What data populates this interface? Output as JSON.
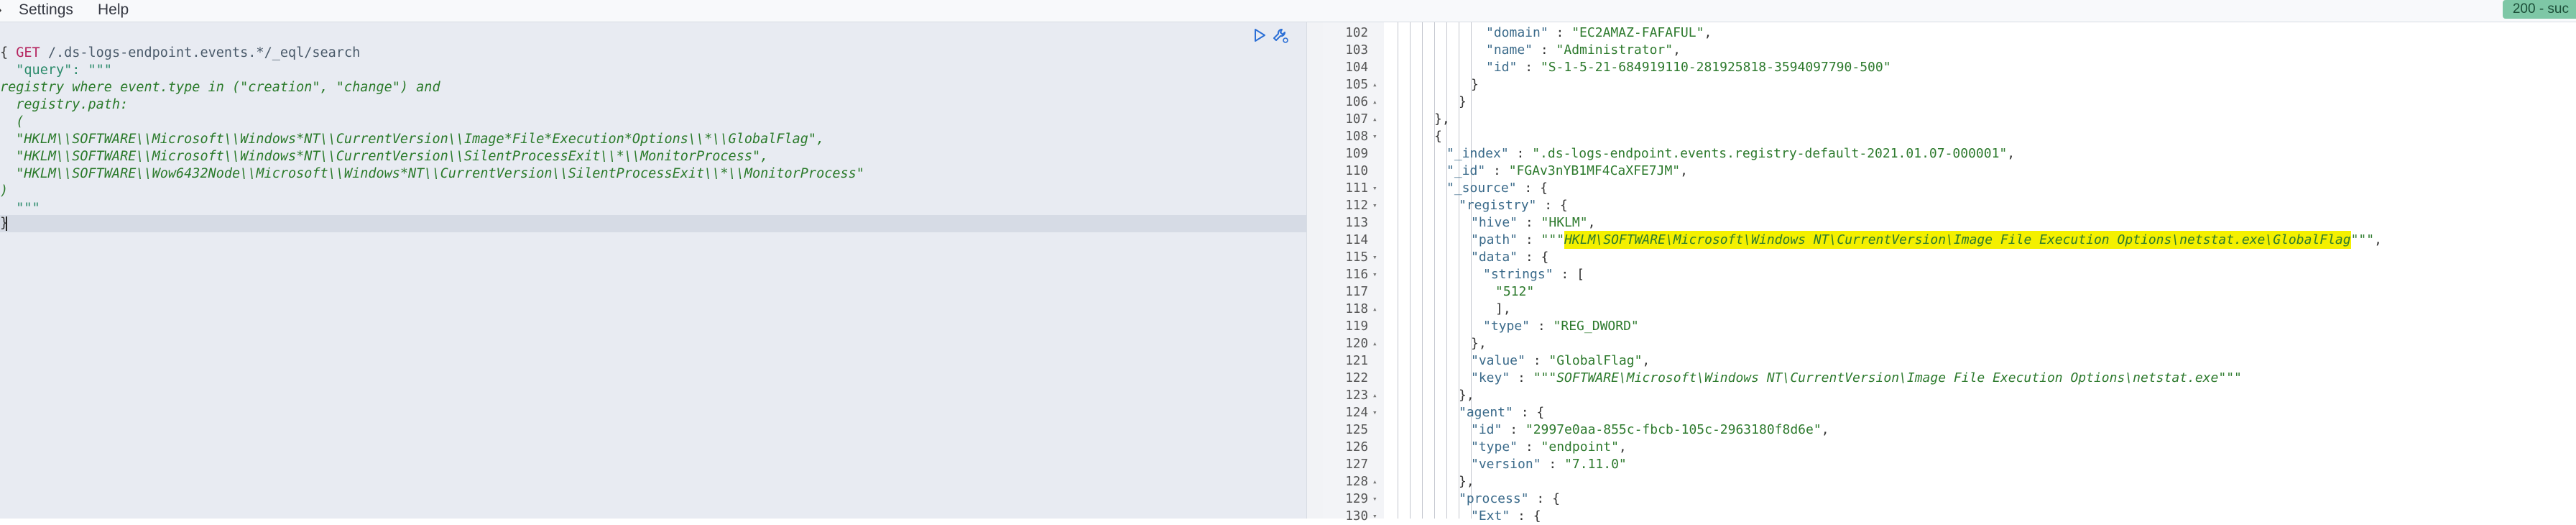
{
  "menubar": {
    "chevron": "›",
    "settings_label": "Settings",
    "help_label": "Help",
    "status_badge": "200 - suc"
  },
  "request": {
    "method": "GET",
    "url": " /.ds-logs-endpoint.events.*/_eql/search",
    "lines": [
      "{",
      "  \"query\": \"\"\"",
      "registry where event.type in (\"creation\", \"change\") and",
      "  registry.path:",
      "  (",
      "  \"HKLM\\\\SOFTWARE\\\\Microsoft\\\\Windows*NT\\\\CurrentVersion\\\\Image*File*Execution*Options\\\\*\\\\GlobalFlag\",",
      "  \"HKLM\\\\SOFTWARE\\\\Microsoft\\\\Windows*NT\\\\CurrentVersion\\\\SilentProcessExit\\\\*\\\\MonitorProcess\",",
      "  \"HKLM\\\\SOFTWARE\\\\Wow6432Node\\\\Microsoft\\\\Windows*NT\\\\CurrentVersion\\\\SilentProcessExit\\\\*\\\\MonitorProcess\"",
      ")",
      "  \"\"\"",
      "}"
    ]
  },
  "response": {
    "line_numbers": [
      "102",
      "103",
      "104",
      "105",
      "106",
      "107",
      "108",
      "109",
      "110",
      "111",
      "112",
      "113",
      "114",
      "115",
      "116",
      "117",
      "118",
      "119",
      "120",
      "121",
      "122",
      "123",
      "124",
      "125",
      "126",
      "127",
      "128",
      "129",
      "130"
    ],
    "fold_markers": [
      "",
      "",
      "",
      "▴",
      "▴",
      "▴",
      "▾",
      "",
      "",
      "▾",
      "▾",
      "",
      "",
      "▾",
      "▾",
      "",
      "▴",
      "",
      "▴",
      "",
      "",
      "▴",
      "▾",
      "",
      "",
      "",
      "▴",
      "▾",
      "▾"
    ],
    "line_102": {
      "key": "\"domain\"",
      "sep": " : ",
      "value": "\"EC2AMAZ-FAFAFUL\"",
      "end": ","
    },
    "line_103": {
      "key": "\"name\"",
      "sep": " : ",
      "value": "\"Administrator\"",
      "end": ","
    },
    "line_104": {
      "key": "\"id\"",
      "sep": " : ",
      "value": "\"S-1-5-21-684919110-281925818-3594097790-500\"",
      "end": ""
    },
    "line_105": "}",
    "line_106": "}",
    "line_107": "},",
    "line_108": "{",
    "line_109": {
      "key": "\"_index\"",
      "sep": " : ",
      "value": "\".ds-logs-endpoint.events.registry-default-2021.01.07-000001\"",
      "end": ","
    },
    "line_110": {
      "key": "\"_id\"",
      "sep": " : ",
      "value": "\"FGAv3nYB1MF4CaXFE7JM\"",
      "end": ","
    },
    "line_111": {
      "key": "\"_source\"",
      "sep": " : ",
      "value": "{"
    },
    "line_112": {
      "key": "\"registry\"",
      "sep": " : ",
      "value": "{"
    },
    "line_113": {
      "key": "\"hive\"",
      "sep": " : ",
      "value": "\"HKLM\"",
      "end": ","
    },
    "line_114": {
      "key": "\"path\"",
      "sep": " : ",
      "quote_open": "\"\"\"",
      "value": "HKLM\\SOFTWARE\\Microsoft\\Windows NT\\CurrentVersion\\Image File Execution Options\\netstat.exe\\GlobalFlag",
      "quote_close": "\"\"\"",
      "end": ","
    },
    "line_115": {
      "key": "\"data\"",
      "sep": " : ",
      "value": "{"
    },
    "line_116": {
      "key": "\"strings\"",
      "sep": " : ",
      "value": "["
    },
    "line_117": "\"512\"",
    "line_118": "],",
    "line_119": {
      "key": "\"type\"",
      "sep": " : ",
      "value": "\"REG_DWORD\""
    },
    "line_120": "},",
    "line_121": {
      "key": "\"value\"",
      "sep": " : ",
      "value": "\"GlobalFlag\"",
      "end": ","
    },
    "line_122": {
      "key": "\"key\"",
      "sep": " : ",
      "quote_open": "\"\"\"",
      "value": "SOFTWARE\\Microsoft\\Windows NT\\CurrentVersion\\Image File Execution Options\\netstat.exe",
      "quote_close": "\"\"\""
    },
    "line_123": "},",
    "line_124": {
      "key": "\"agent\"",
      "sep": " : ",
      "value": "{"
    },
    "line_125": {
      "key": "\"id\"",
      "sep": " : ",
      "value": "\"2997e0aa-855c-fbcb-105c-2963180f8d6e\"",
      "end": ","
    },
    "line_126": {
      "key": "\"type\"",
      "sep": " : ",
      "value": "\"endpoint\"",
      "end": ","
    },
    "line_127": {
      "key": "\"version\"",
      "sep": " : ",
      "value": "\"7.11.0\""
    },
    "line_128": "},",
    "line_129": {
      "key": "\"process\"",
      "sep": " : ",
      "value": "{"
    },
    "line_130": {
      "key": "\"Ext\"",
      "sep": " : ",
      "value": "{"
    }
  },
  "colors": {
    "method": "#b5245f",
    "string": "#2d7a2d",
    "highlight": "#f4f000",
    "status_badge": "#7ec7a6"
  }
}
